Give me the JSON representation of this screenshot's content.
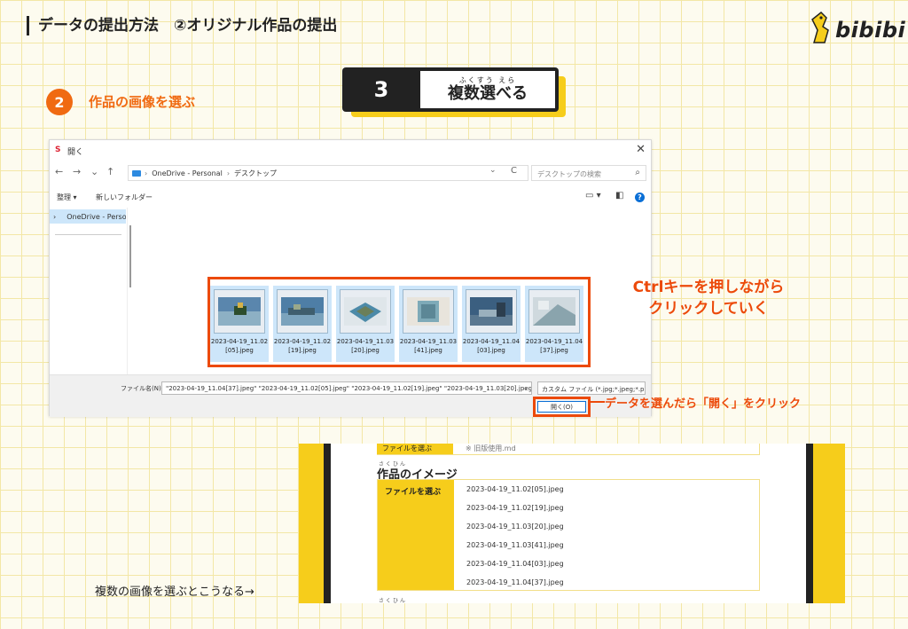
{
  "header": {
    "title": "データの提出方法　②オリジナル作品の提出",
    "logo_text": "bibibi"
  },
  "step": {
    "number": "2",
    "label": "作品の画像を選ぶ"
  },
  "badge": {
    "number": "3",
    "ruby": "ふくすう えら",
    "label": "複数選べる"
  },
  "dialog": {
    "title": "開く",
    "app_icon": "S",
    "close_icon": "✕",
    "nav": {
      "back": "←",
      "forward": "→",
      "down": "⌄",
      "up": "↑",
      "refresh": "C"
    },
    "address": [
      "OneDrive - Personal",
      "デスクトップ"
    ],
    "search_placeholder": "デスクトップの検索",
    "toolbar": {
      "organize": "整理 ▾",
      "new_folder": "新しいフォルダー"
    },
    "sidebar_item": "OneDrive - Perso",
    "files": [
      {
        "name": "2023-04-19_11.02 [05].jpeg"
      },
      {
        "name": "2023-04-19_11.02 [19].jpeg"
      },
      {
        "name": "2023-04-19_11.03 [20].jpeg"
      },
      {
        "name": "2023-04-19_11.03 [41].jpeg"
      },
      {
        "name": "2023-04-19_11.04 [03].jpeg"
      },
      {
        "name": "2023-04-19_11.04 [37].jpeg"
      }
    ],
    "filename_label": "ファイル名(N):",
    "filename_value": "\"2023-04-19_11.04[37].jpeg\" \"2023-04-19_11.02[05].jpeg\" \"2023-04-19_11.02[19].jpeg\" \"2023-04-19_11.03[20].jpeg\" \"2023-",
    "filetype": "カスタム ファイル (*.jpg;*.jpeg;*.pn",
    "open_button": "開く(O)"
  },
  "annotations": {
    "ctrl_line1": "Ctrlキーを押しながら",
    "ctrl_line2": "クリックしていく",
    "open_hint": "データを選んだら「開く」をクリック"
  },
  "result": {
    "top_label": "ファイルを選ぶ",
    "top_value": "※ 旧版使用.md",
    "ruby": "さくひん",
    "heading": "作品のイメージ",
    "field_label": "ファイルを選ぶ",
    "files": [
      "2023-04-19_11.02[05].jpeg",
      "2023-04-19_11.02[19].jpeg",
      "2023-04-19_11.03[20].jpeg",
      "2023-04-19_11.03[41].jpeg",
      "2023-04-19_11.04[03].jpeg",
      "2023-04-19_11.04[37].jpeg"
    ],
    "bottom_ruby": "さくひん",
    "caption": "複数の画像を選ぶとこうなる→"
  },
  "colors": {
    "accent": "#ec4a0b",
    "yellow": "#f6cd1b",
    "selection": "#cde6fa"
  }
}
